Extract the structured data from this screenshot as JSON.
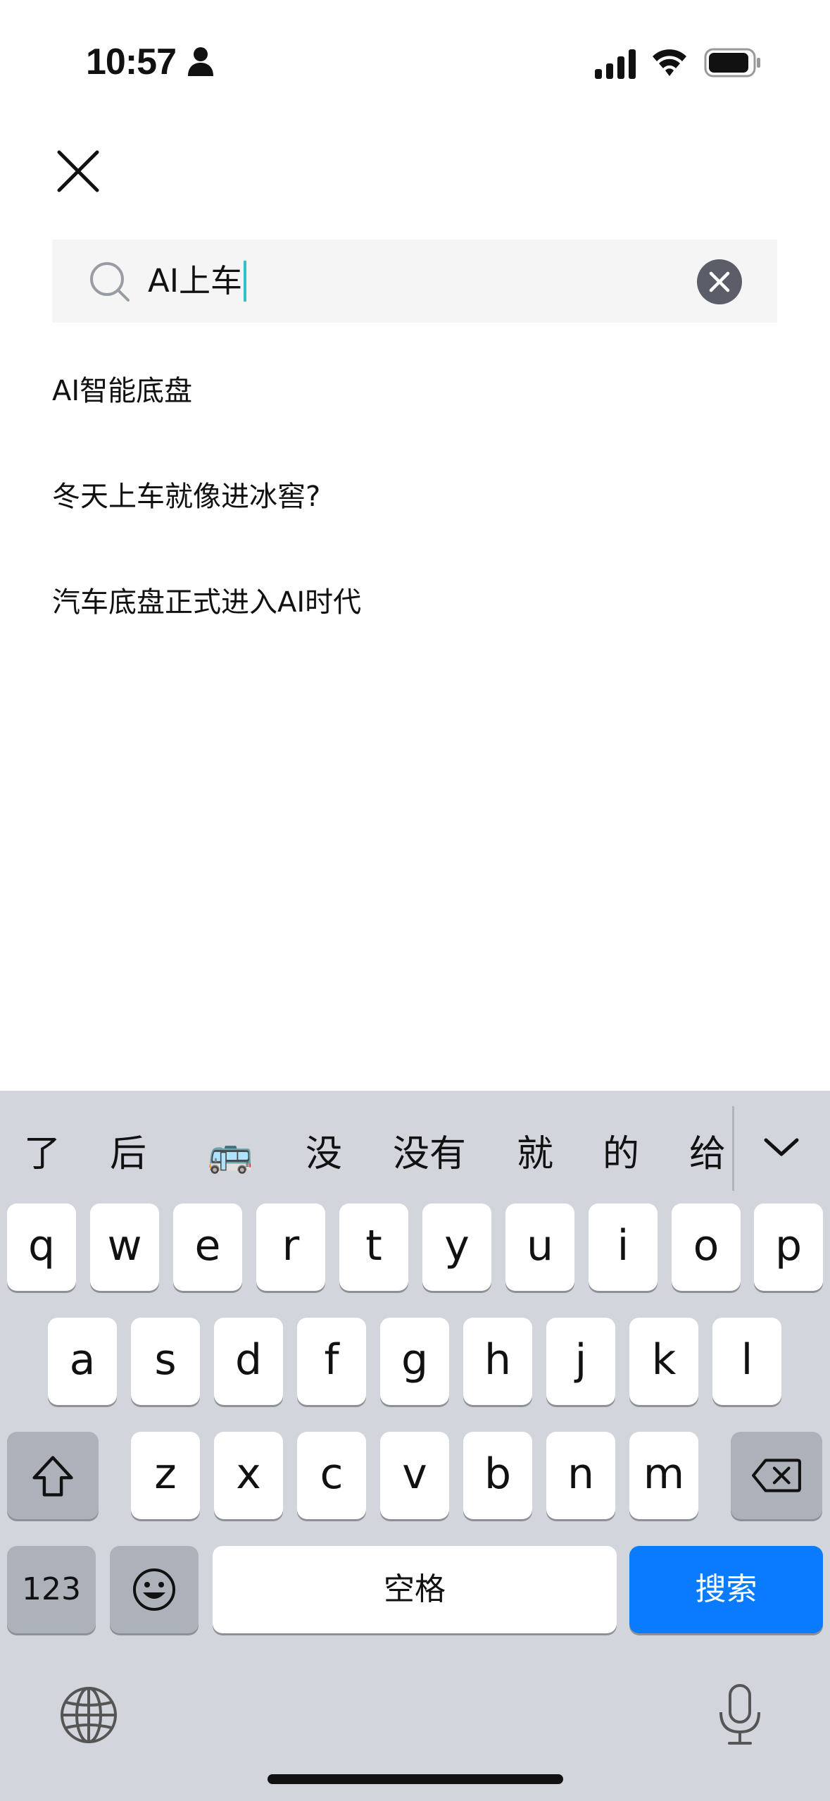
{
  "status_bar": {
    "time": "10:57"
  },
  "search": {
    "query": "AI上车"
  },
  "suggestions": [
    "AI智能底盘",
    "冬天上车就像进冰窖?",
    "汽车底盘正式进入AI时代"
  ],
  "keyboard": {
    "candidates": [
      "了",
      "后",
      "🚌",
      "没",
      "没有",
      "就",
      "的",
      "给"
    ],
    "row1": [
      "q",
      "w",
      "e",
      "r",
      "t",
      "y",
      "u",
      "i",
      "o",
      "p"
    ],
    "row2": [
      "a",
      "s",
      "d",
      "f",
      "g",
      "h",
      "j",
      "k",
      "l"
    ],
    "row3": [
      "z",
      "x",
      "c",
      "v",
      "b",
      "n",
      "m"
    ],
    "numbers_key": "123",
    "space_key": "空格",
    "search_key": "搜索"
  },
  "colors": {
    "accent_blue": "#0a7bfe",
    "caret": "#2ec2c9",
    "keyboard_bg": "#d2d5dc"
  }
}
